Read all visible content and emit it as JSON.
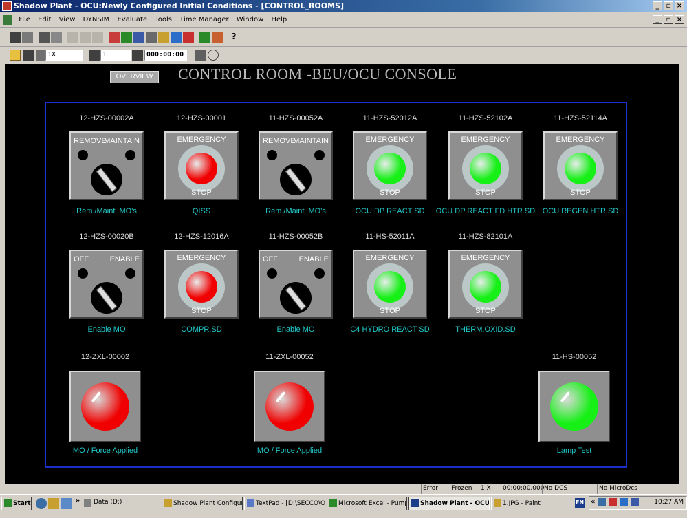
{
  "window": {
    "title": "Shadow Plant - OCU:Newly Configured Initial Conditions - [CONTROL_ROOMS]"
  },
  "menu": [
    "File",
    "Edit",
    "View",
    "DYNSIM",
    "Evaluate",
    "Tools",
    "Time Manager",
    "Window",
    "Help"
  ],
  "toolbar": {
    "speed": "1X",
    "step": "1",
    "time": "000:00:00"
  },
  "screen": {
    "overview_label": "OVERVIEW",
    "title": "CONTROL ROOM -BEU/OCU CONSOLE"
  },
  "switches": [
    {
      "tag": "12-HZS-00002A",
      "kind": "selector",
      "left_label": "REMOVE",
      "right_label": "MAINTAIN",
      "caption": "Rem./Maint. MO's"
    },
    {
      "tag": "12-HZS-00001",
      "kind": "button",
      "top_label": "EMERGENCY",
      "bottom_label": "STOP",
      "color": "#f00000",
      "caption": "QISS"
    },
    {
      "tag": "11-HZS-00052A",
      "kind": "selector",
      "left_label": "REMOVE",
      "right_label": "MAINTAIN",
      "caption": "Rem./Maint. MO's"
    },
    {
      "tag": "11-HZS-52012A",
      "kind": "button",
      "top_label": "EMERGENCY",
      "bottom_label": "STOP",
      "color": "#16f016",
      "caption": "OCU DP REACT SD"
    },
    {
      "tag": "11-HZS-52102A",
      "kind": "button",
      "top_label": "EMERGENCY",
      "bottom_label": "STOP",
      "color": "#16f016",
      "caption": "OCU DP REACT FD HTR SD"
    },
    {
      "tag": "11-HZS-52114A",
      "kind": "button",
      "top_label": "EMERGENCY",
      "bottom_label": "STOP",
      "color": "#16f016",
      "caption": "OCU REGEN HTR SD"
    },
    {
      "tag": "12-HZS-00020B",
      "kind": "selector",
      "left_label": "OFF",
      "right_label": "ENABLE",
      "caption": "Enable MO"
    },
    {
      "tag": "12-HZS-12016A",
      "kind": "button",
      "top_label": "EMERGENCY",
      "bottom_label": "STOP",
      "color": "#f00000",
      "caption": "COMPR.SD"
    },
    {
      "tag": "11-HZS-00052B",
      "kind": "selector",
      "left_label": "OFF",
      "right_label": "ENABLE",
      "caption": "Enable MO"
    },
    {
      "tag": "11-HS-52011A",
      "kind": "button",
      "top_label": "EMERGENCY",
      "bottom_label": "STOP",
      "color": "#16f016",
      "caption": "C4 HYDRO REACT SD"
    },
    {
      "tag": "11-HZS-82101A",
      "kind": "button",
      "top_label": "EMERGENCY",
      "bottom_label": "STOP",
      "color": "#16f016",
      "caption": "THERM.OXID.SD"
    }
  ],
  "lamps": [
    {
      "tag": "12-ZXL-00002",
      "color": "#f00000",
      "caption": "MO / Force Applied"
    },
    {
      "tag": "11-ZXL-00052",
      "color": "#f00000",
      "caption": "MO / Force Applied"
    },
    {
      "tag": "11-HS-00052",
      "color": "#16f016",
      "caption": "Lamp Test"
    }
  ],
  "status": {
    "error_log": "Error Log",
    "frozen": "Frozen",
    "speed": "1 X",
    "time": "00:00:00.000",
    "dcs": "No DCS",
    "microdcs": "No MicroDcs"
  },
  "taskbar": {
    "start": "Start",
    "quick": "Data (D:)",
    "tasks": [
      "Shadow Plant Configur...",
      "TextPad - [D:\\SECCO\\O...",
      "Microsoft Excel - Pump I...",
      "Shadow Plant - OCU:...",
      "1.JPG - Paint"
    ],
    "lang": "EN",
    "clock": "10:27 AM"
  }
}
